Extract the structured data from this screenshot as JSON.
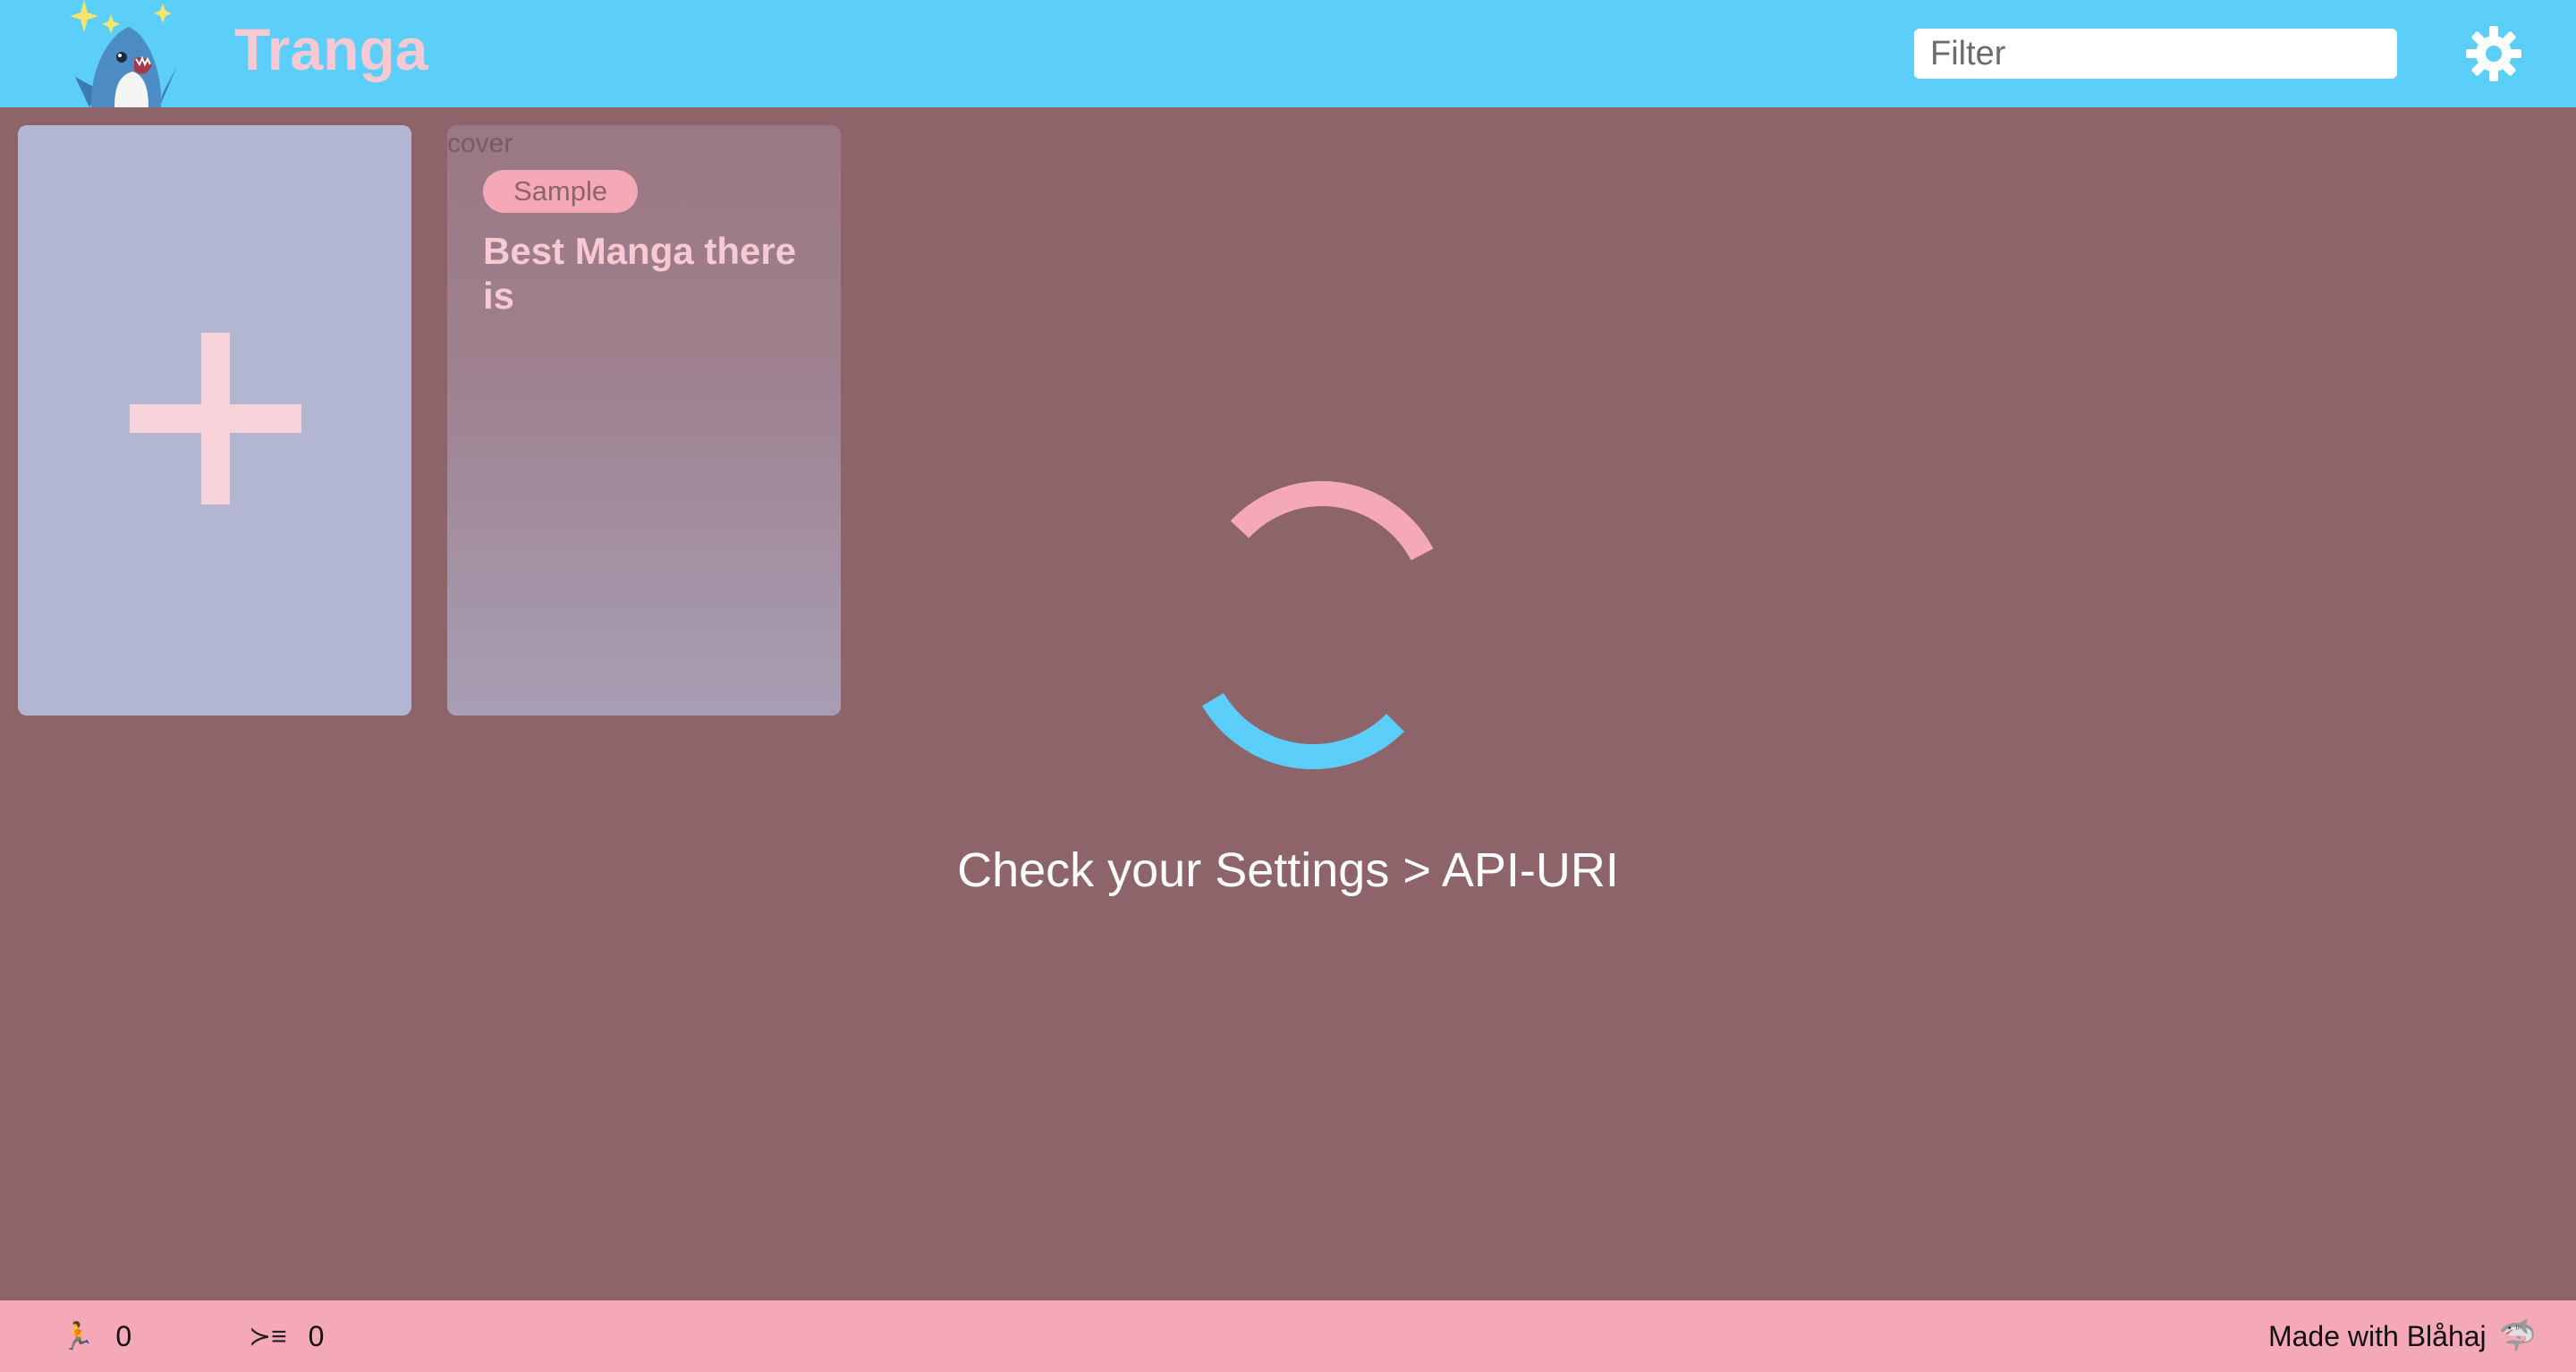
{
  "app": {
    "title": "Tranga"
  },
  "search": {
    "placeholder": "Filter",
    "value": ""
  },
  "icons": {
    "logo": "blahaj-shark-logo",
    "settings": "gear-icon",
    "add": "plus-icon",
    "running": "runner-icon",
    "queue": "queue-list-icon",
    "shark": "shark-icon"
  },
  "cards": {
    "manga": {
      "cover_alt": "cover",
      "badge": "Sample",
      "title": "Best Manga there is"
    }
  },
  "loading": {
    "message": "Check your Settings > API-URI"
  },
  "footer": {
    "running_icon": "🏃",
    "running_count": "0",
    "queue_icon": "⁠≻≡",
    "queue_count": "0",
    "made_with": "Made with Blåhaj",
    "shark_glyph": "🦈"
  },
  "colors": {
    "header": "#5bcefa",
    "background": "#8e646b",
    "footer": "#f5a9b8",
    "accent_pink": "#f5a9b8",
    "accent_blue": "#5bcefa"
  }
}
